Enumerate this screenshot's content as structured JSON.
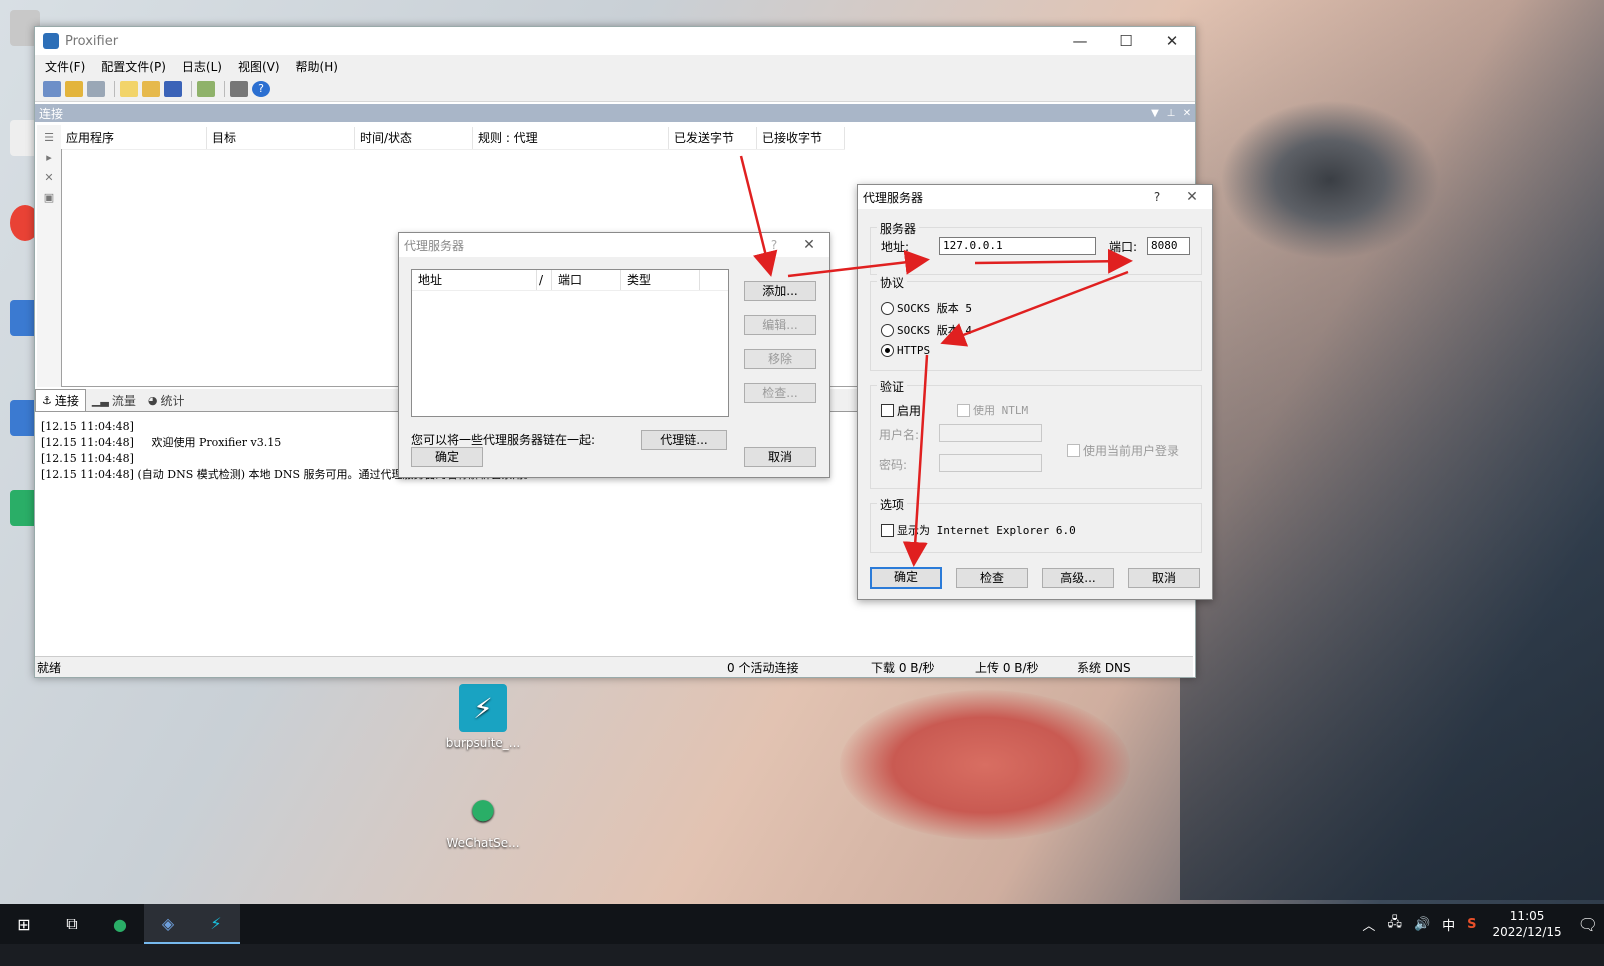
{
  "window": {
    "title": "Proxifier",
    "menu": [
      "文件(F)",
      "配置文件(P)",
      "日志(L)",
      "视图(V)",
      "帮助(H)"
    ],
    "panel_title": "连接",
    "columns": [
      "应用程序",
      "目标",
      "时间/状态",
      "规则 : 代理",
      "已发送字节",
      "已接收字节"
    ],
    "tabs": [
      "连接",
      "流量",
      "统计"
    ],
    "log": [
      "[12.15 11:04:48]",
      "[12.15 11:04:48]     欢迎使用 Proxifier v3.15",
      "[12.15 11:04:48]",
      "[12.15 11:04:48] (自动 DNS 模式检测) 本地 DNS 服务可用。通过代理服务器的名称解析已禁用。"
    ],
    "status": {
      "ready": "就绪",
      "active": "0 个活动连接",
      "down": "下载 0 B/秒",
      "up": "上传 0 B/秒",
      "dns": "系统 DNS"
    }
  },
  "proxy_list_dialog": {
    "title": "代理服务器",
    "columns": [
      "地址",
      "/",
      "端口",
      "类型"
    ],
    "add": "添加...",
    "edit": "编辑...",
    "remove": "移除",
    "check": "检查...",
    "chain_text": "您可以将一些代理服务器链在一起:",
    "chain_button": "代理链...",
    "ok": "确定",
    "cancel": "取消"
  },
  "proxy_dialog": {
    "title": "代理服务器",
    "help": "?",
    "server_group": "服务器",
    "address_label": "地址:",
    "address_value": "127.0.0.1",
    "port_label": "端口:",
    "port_value": "8080",
    "protocol_group": "协议",
    "protocols": [
      "SOCKS 版本 5",
      "SOCKS 版本 4",
      "HTTPS"
    ],
    "selected_protocol": "HTTPS",
    "auth_group": "验证",
    "enable": "启用",
    "use_ntlm": "使用 NTLM",
    "username_label": "用户名:",
    "password_label": "密码:",
    "use_current_user": "使用当前用户登录",
    "options_group": "选项",
    "show_as_ie": "显示为 Internet Explorer 6.0",
    "ok": "确定",
    "check": "检查",
    "advanced": "高级...",
    "cancel": "取消"
  },
  "desktop": {
    "icons": [
      "burpsuite_...",
      "WeChatSe..."
    ]
  },
  "taskbar": {
    "ime": "中",
    "time": "11:05",
    "date": "2022/12/15"
  },
  "colors": {
    "accent": "#2b7bd8",
    "annotation": "#e02020",
    "panel_header": "#a9b6c8"
  }
}
